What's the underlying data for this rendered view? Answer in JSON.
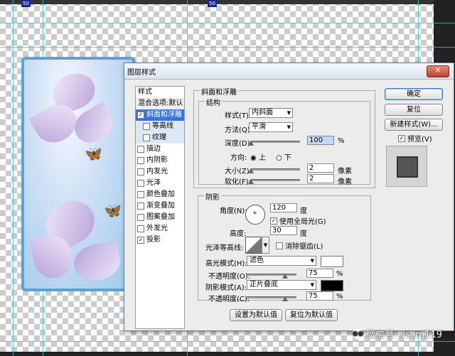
{
  "canvas": {
    "ruler_tags": [
      "50",
      "50"
    ]
  },
  "dialog": {
    "title": "图层样式",
    "close_glyph": "✕"
  },
  "styles_panel": {
    "header": "样式",
    "blend_options": "混合选项:默认",
    "items": [
      {
        "label": "斜面和浮雕",
        "checked": true,
        "selected": true
      },
      {
        "label": "等高线",
        "checked": false,
        "sub": true
      },
      {
        "label": "纹理",
        "checked": false,
        "sub": true
      },
      {
        "label": "描边",
        "checked": false
      },
      {
        "label": "内阴影",
        "checked": false
      },
      {
        "label": "内发光",
        "checked": false
      },
      {
        "label": "光泽",
        "checked": false
      },
      {
        "label": "颜色叠加",
        "checked": false
      },
      {
        "label": "渐变叠加",
        "checked": false
      },
      {
        "label": "图案叠加",
        "checked": false
      },
      {
        "label": "外发光",
        "checked": false
      },
      {
        "label": "投影",
        "checked": true
      }
    ]
  },
  "bevel": {
    "section_title": "斜面和浮雕",
    "structure_title": "结构",
    "style_label": "样式(T):",
    "style_value": "内斜面",
    "technique_label": "方法(Q):",
    "technique_value": "平滑",
    "depth_label": "深度(D):",
    "depth_value": "100",
    "depth_unit": "%",
    "direction_label": "方向:",
    "direction_up": "上",
    "direction_down": "下",
    "size_label": "大小(Z):",
    "size_value": "2",
    "size_unit": "像素",
    "soften_label": "软化(F):",
    "soften_value": "2",
    "soften_unit": "像素"
  },
  "shading": {
    "title": "阴影",
    "angle_label": "角度(N):",
    "angle_value": "120",
    "angle_unit": "度",
    "global_light_label": "使用全局光(G)",
    "altitude_label": "高度:",
    "altitude_value": "30",
    "altitude_unit": "度",
    "gloss_contour_label": "光泽等高线:",
    "anti_alias_label": "消除锯齿(L)",
    "highlight_mode_label": "高光模式(H):",
    "highlight_mode_value": "滤色",
    "highlight_opacity_label": "不透明度(O):",
    "highlight_opacity_value": "75",
    "shadow_mode_label": "阴影模式(A):",
    "shadow_mode_value": "正片叠底",
    "shadow_opacity_label": "不透明度(C):",
    "shadow_opacity_value": "75",
    "percent": "%",
    "highlight_color": "#ffffff",
    "shadow_color": "#000000"
  },
  "footer": {
    "make_default": "设置为默认值",
    "reset_default": "复位为默认值"
  },
  "side_buttons": {
    "ok": "确定",
    "reset": "复位",
    "new_style": "新建样式(W)...",
    "preview_label": "预览(V)"
  },
  "watermark": {
    "text": "微信号: yscm119"
  }
}
